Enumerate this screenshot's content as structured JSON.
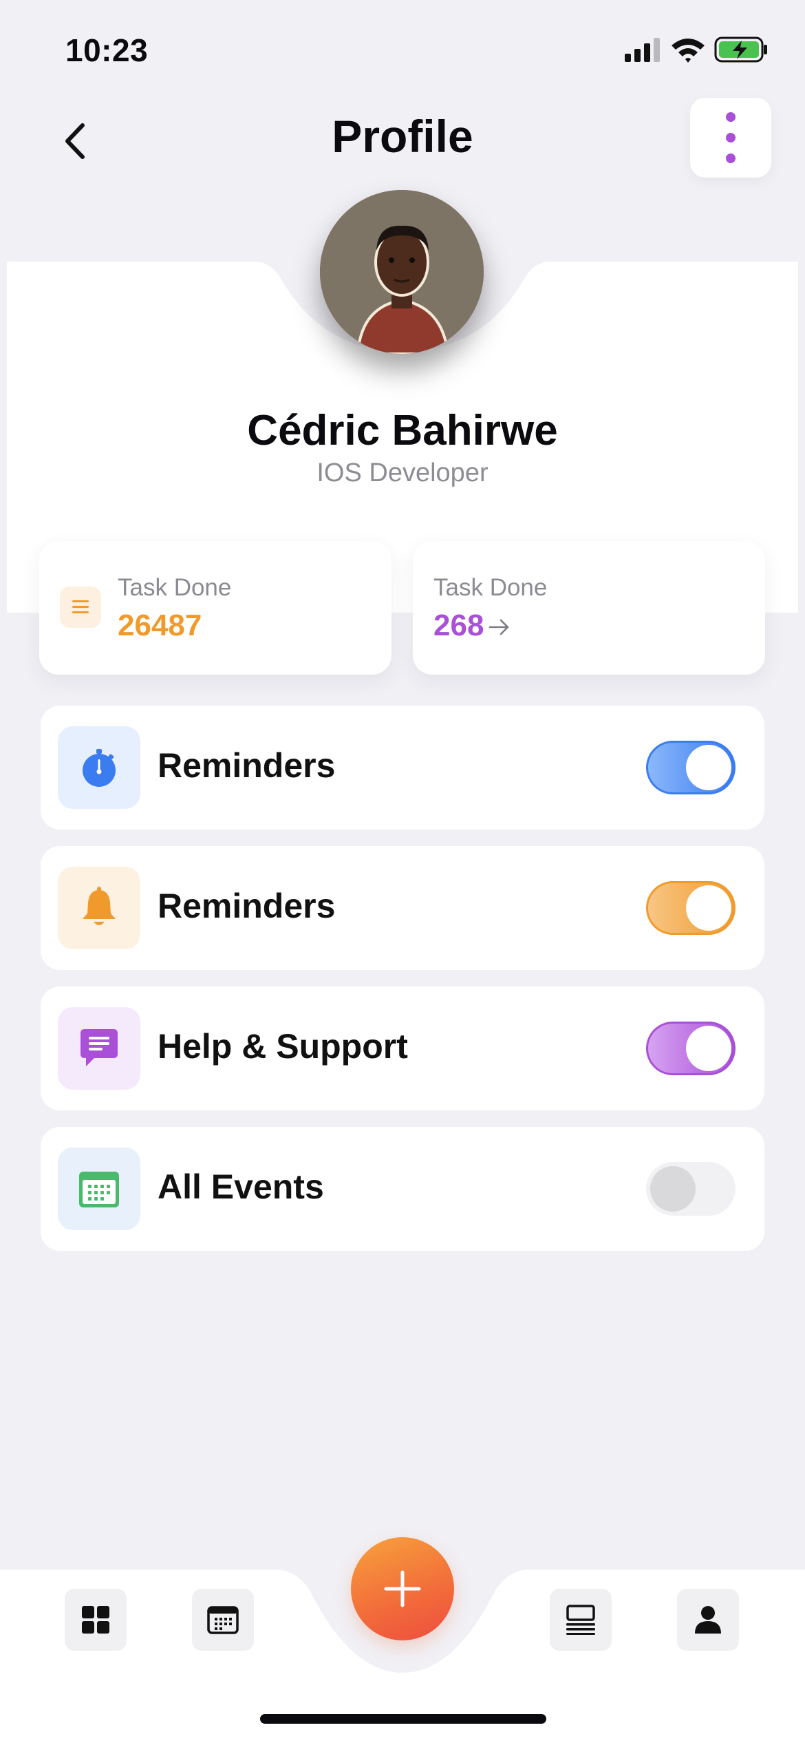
{
  "status_bar": {
    "time": "10:23"
  },
  "header": {
    "title": "Profile"
  },
  "profile": {
    "name": "Cédric Bahirwe",
    "role": "IOS Developer"
  },
  "stats": [
    {
      "label": "Task Done",
      "value": "26487",
      "icon": "list-icon"
    },
    {
      "label": "Task Done",
      "value": "268",
      "icon": "arrow-right-icon"
    }
  ],
  "settings": [
    {
      "label": "Reminders",
      "icon": "stopwatch-icon",
      "enabled": true
    },
    {
      "label": "Reminders",
      "icon": "bell-icon",
      "enabled": true
    },
    {
      "label": "Help & Support",
      "icon": "chat-icon",
      "enabled": true
    },
    {
      "label": "All Events",
      "icon": "calendar-icon",
      "enabled": false
    }
  ],
  "colors": {
    "background": "#f1f0f5",
    "blue": "#3b7cf0",
    "orange": "#f19a2c",
    "purple": "#a94fd8",
    "green": "#49b96b"
  },
  "tab_bar": {
    "icons": [
      "grid-icon",
      "calendar-icon",
      "add-icon",
      "list-icon",
      "person-icon"
    ]
  }
}
